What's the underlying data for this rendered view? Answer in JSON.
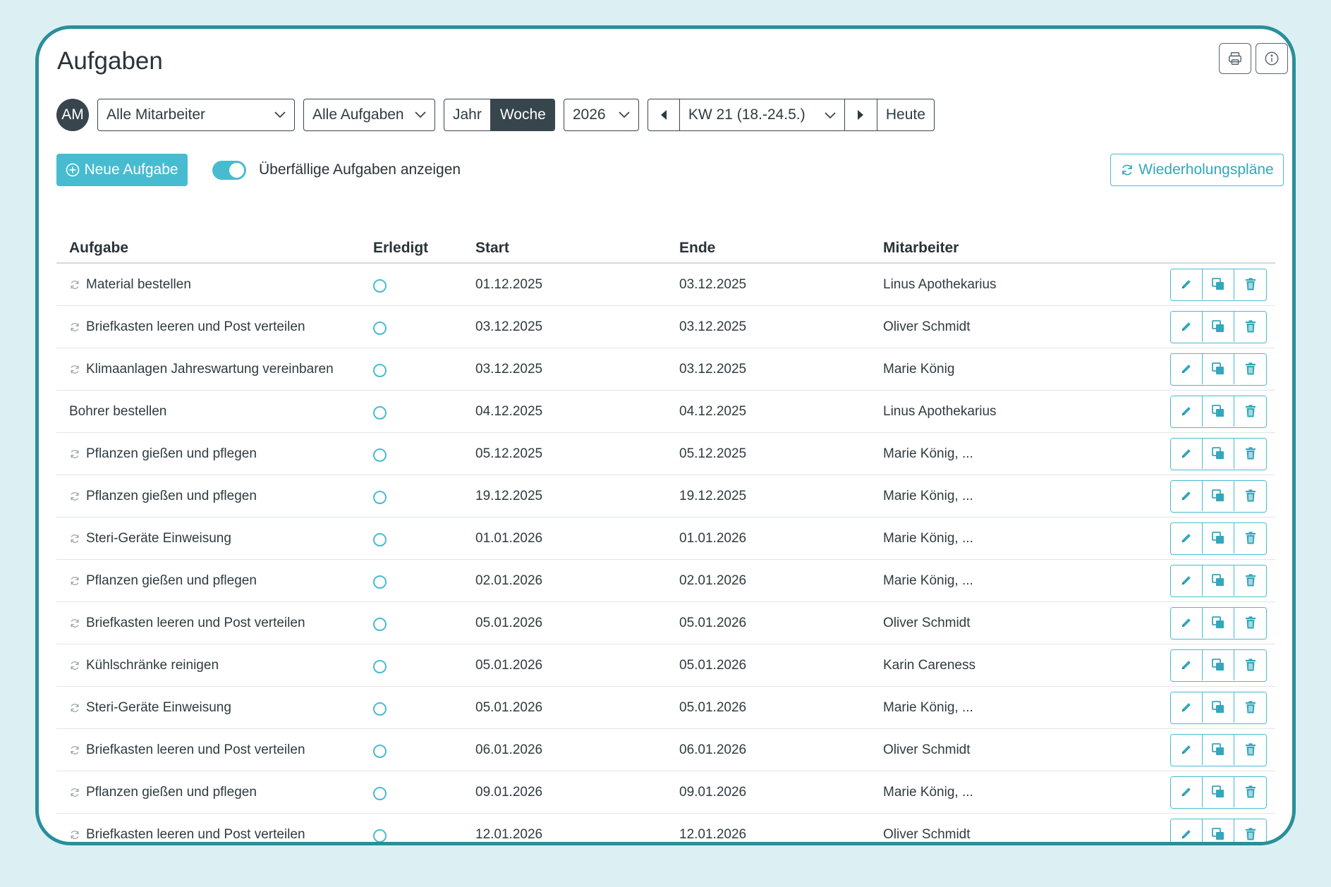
{
  "page": {
    "title": "Aufgaben"
  },
  "header_icons": [
    "printer-icon",
    "info-icon"
  ],
  "filters": {
    "avatar_initials": "AM",
    "employee_select": "Alle Mitarbeiter",
    "task_select": "Alle Aufgaben",
    "view_toggle": {
      "year": "Jahr",
      "week": "Woche",
      "selected": "Woche"
    },
    "year_select": "2026",
    "week_select": "KW 21 (18.-24.5.)",
    "today_button": "Heute"
  },
  "actions": {
    "new_task": "Neue Aufgabe",
    "overdue_toggle_label": "Überfällige Aufgaben anzeigen",
    "overdue_toggle_on": true,
    "repeat_plans": "Wiederholungspläne"
  },
  "colors": {
    "accent": "#47bcd0",
    "frame": "#2a8f9a",
    "dark": "#37454d",
    "background": "#dcf0f4"
  },
  "table": {
    "headers": {
      "task": "Aufgabe",
      "done": "Erledigt",
      "start": "Start",
      "end": "Ende",
      "employee": "Mitarbeiter"
    },
    "rows": [
      {
        "task": "Material bestellen",
        "recurring": true,
        "done": false,
        "start": "01.12.2025",
        "end": "03.12.2025",
        "employee": "Linus Apothekarius"
      },
      {
        "task": "Briefkasten leeren und Post verteilen",
        "recurring": true,
        "done": false,
        "start": "03.12.2025",
        "end": "03.12.2025",
        "employee": "Oliver Schmidt"
      },
      {
        "task": "Klimaanlagen Jahreswartung vereinbaren",
        "recurring": true,
        "done": false,
        "start": "03.12.2025",
        "end": "03.12.2025",
        "employee": "Marie König"
      },
      {
        "task": "Bohrer bestellen",
        "recurring": false,
        "done": false,
        "start": "04.12.2025",
        "end": "04.12.2025",
        "employee": "Linus Apothekarius"
      },
      {
        "task": "Pflanzen gießen und pflegen",
        "recurring": true,
        "done": false,
        "start": "05.12.2025",
        "end": "05.12.2025",
        "employee": "Marie König, ..."
      },
      {
        "task": "Pflanzen gießen und pflegen",
        "recurring": true,
        "done": false,
        "start": "19.12.2025",
        "end": "19.12.2025",
        "employee": "Marie König, ..."
      },
      {
        "task": "Steri-Geräte Einweisung",
        "recurring": true,
        "done": false,
        "start": "01.01.2026",
        "end": "01.01.2026",
        "employee": "Marie König, ..."
      },
      {
        "task": "Pflanzen gießen und pflegen",
        "recurring": true,
        "done": false,
        "start": "02.01.2026",
        "end": "02.01.2026",
        "employee": "Marie König, ..."
      },
      {
        "task": "Briefkasten leeren und Post verteilen",
        "recurring": true,
        "done": false,
        "start": "05.01.2026",
        "end": "05.01.2026",
        "employee": "Oliver Schmidt"
      },
      {
        "task": "Kühlschränke reinigen",
        "recurring": true,
        "done": false,
        "start": "05.01.2026",
        "end": "05.01.2026",
        "employee": "Karin Careness"
      },
      {
        "task": "Steri-Geräte Einweisung",
        "recurring": true,
        "done": false,
        "start": "05.01.2026",
        "end": "05.01.2026",
        "employee": "Marie König, ..."
      },
      {
        "task": "Briefkasten leeren und Post verteilen",
        "recurring": true,
        "done": false,
        "start": "06.01.2026",
        "end": "06.01.2026",
        "employee": "Oliver Schmidt"
      },
      {
        "task": "Pflanzen gießen und pflegen",
        "recurring": true,
        "done": false,
        "start": "09.01.2026",
        "end": "09.01.2026",
        "employee": "Marie König, ..."
      },
      {
        "task": "Briefkasten leeren und Post verteilen",
        "recurring": true,
        "done": false,
        "start": "12.01.2026",
        "end": "12.01.2026",
        "employee": "Oliver Schmidt"
      }
    ],
    "row_actions": [
      "pencil-icon",
      "copy-icon",
      "trash-icon"
    ]
  }
}
